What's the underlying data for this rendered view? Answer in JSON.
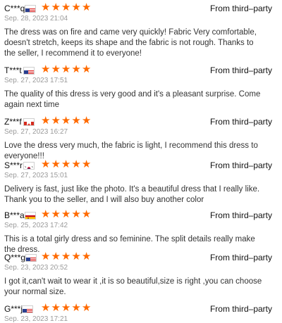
{
  "source_label": "From third–party",
  "rating_icon": "star-icon",
  "accent_color": "#ff6a00",
  "reviews": [
    {
      "user": "C***q",
      "flag_country": "US",
      "rating": 5,
      "date": "Sep. 28, 2023 21:04",
      "text": "The dress was on fire and came very quickly! Fabric Very comfortable, doesn't stretch, keeps its shape and the fabric is not rough. Thanks to the seller, I recommend it to everyone!"
    },
    {
      "user": "T***t",
      "flag_country": "US",
      "rating": 5,
      "date": "Sep. 27, 2023 17:51",
      "text": "The quality of this dress is very good and it's a pleasant surprise. Come again next time"
    },
    {
      "user": "Z***f",
      "flag_country": "CA",
      "rating": 5,
      "date": "Sep. 27, 2023 16:27",
      "text": "Love the dress very much, the fabric is light, I recommend this dress to everyone!!!"
    },
    {
      "user": "S***r",
      "flag_country": "KR",
      "rating": 5,
      "date": "Sep. 27, 2023 15:01",
      "text": "Delivery is fast, just like the photo. It's a beautiful dress that I really like. Thank you to the seller, and I will also buy another color"
    },
    {
      "user": "B***a",
      "flag_country": "ES",
      "rating": 5,
      "date": "Sep. 25, 2023 17:42",
      "text": "This is a total girly dress and so feminine. The split details really make the dress."
    },
    {
      "user": "Q***g",
      "flag_country": "US",
      "rating": 5,
      "date": "Sep. 23, 2023 20:52",
      "text": "I got it,can't wait to wear it ,it is so beautiful,size is right ,you can choose your normal size."
    },
    {
      "user": "G***j",
      "flag_country": "US",
      "rating": 5,
      "date": "Sep. 23, 2023 17:21",
      "text": ""
    }
  ]
}
